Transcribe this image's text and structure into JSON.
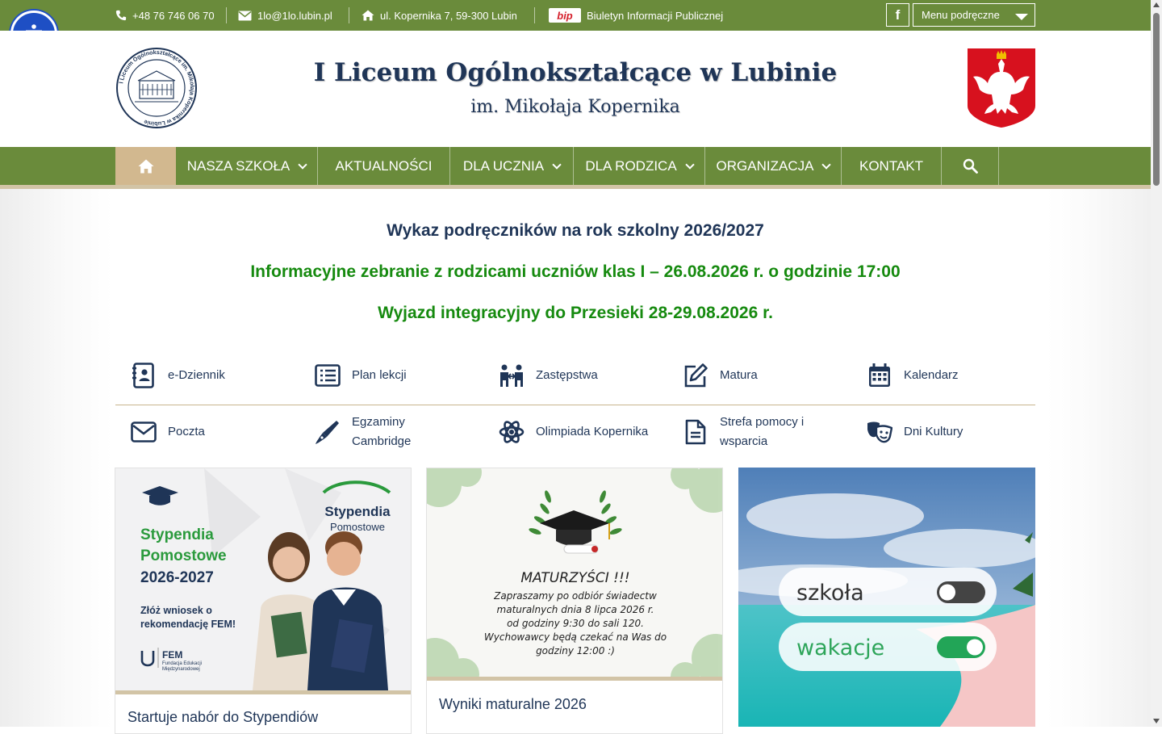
{
  "topbar": {
    "phone": "+48 76 746 06 70",
    "email": "1lo@1lo.lubin.pl",
    "address": "ul. Kopernika 7, 59-300 Lubin",
    "bip_logo": "bip",
    "bip_label": "Biuletyn Informacji Publicznej",
    "facebook": "f",
    "menu_select": "Menu podręczne"
  },
  "header": {
    "title": "I Liceum Ogólnokształcące w Lubinie",
    "subtitle": "im. Mikołaja Kopernika",
    "seal_text": "I Liceum Ogólnokształcące im. Mikołaja Kopernika w Lubinie"
  },
  "nav": {
    "items": [
      "NASZA SZKOŁA",
      "AKTUALNOŚCI",
      "DLA UCZNIA",
      "DLA RODZICA",
      "ORGANIZACJA",
      "KONTAKT"
    ]
  },
  "notices": [
    "Wykaz podręczników na rok szkolny 2026/2027",
    "Informacyjne zebranie z rodzicami uczniów klas I – 26.08.2026 r. o godzinie 17:00",
    "Wyjazd integracyjny do Przesieki 28-29.08.2026 r."
  ],
  "quick_links": {
    "row1": [
      "e-Dziennik",
      "Plan lekcji",
      "Zastępstwa",
      "Matura",
      "Kalendarz"
    ],
    "row2": [
      "Poczta",
      "Egzaminy",
      "Cambridge",
      "Olimpiada Kopernika",
      "Strefa pomocy i",
      "wsparcia",
      "Dni Kultury"
    ]
  },
  "cards": [
    {
      "title": "Startuje nabór do Stypendiów",
      "img": {
        "brand": "Stypendia",
        "brand_sub": "Pomostowe",
        "headline": [
          "Stypendia",
          "Pomostowe",
          "2026-2027"
        ],
        "cta": [
          "Złóż wniosek o",
          "rekomendację FEM!"
        ],
        "org": "FEM",
        "org_sub": [
          "Fundacja Edukacji",
          "Międzynarodowej"
        ]
      }
    },
    {
      "title": "Wyniki maturalne 2026",
      "img": {
        "heading": "MATURZYŚCI !!!",
        "lines": [
          "Zapraszamy po odbiór świadectw",
          "maturalnych dnia 8 lipca 2026 r.",
          "od godziny 9:30 do sali 120.",
          "Wychowawcy będą czekać na Was do",
          "godziny 12:00 :)"
        ]
      }
    },
    {
      "title": "",
      "img": {
        "toggle1": "szkoła",
        "toggle2": "wakacje"
      }
    }
  ],
  "colors": {
    "green": "#6a8b3b",
    "navy": "#1f3557",
    "notice_green": "#168a0f",
    "beige": "#d2c4a6",
    "a11y_blue": "#1e4fc4"
  },
  "icons": [
    "phone-icon",
    "envelope-icon",
    "home-icon",
    "facebook-icon",
    "accessibility-icon",
    "search-icon",
    "contact-book-icon",
    "list-icon",
    "people-swap-icon",
    "edit-icon",
    "calendar-icon",
    "mail-icon",
    "pen-icon",
    "atom-icon",
    "document-icon",
    "theater-masks-icon"
  ]
}
